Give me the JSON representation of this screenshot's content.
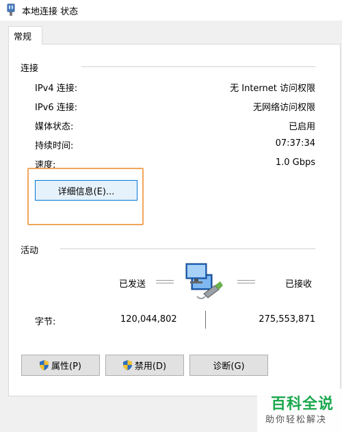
{
  "window": {
    "title": "本地连接 状态"
  },
  "tabs": [
    {
      "label": "常规"
    }
  ],
  "connection": {
    "group_label": "连接",
    "rows": [
      {
        "label": "IPv4 连接:",
        "value": "无 Internet 访问权限"
      },
      {
        "label": "IPv6 连接:",
        "value": "无网络访问权限"
      },
      {
        "label": "媒体状态:",
        "value": "已启用"
      },
      {
        "label": "持续时间:",
        "value": "07:37:34"
      },
      {
        "label": "速度:",
        "value": "1.0 Gbps"
      }
    ],
    "details_button": "详细信息(E)..."
  },
  "activity": {
    "group_label": "活动",
    "sent_label": "已发送",
    "received_label": "已接收",
    "bytes_label": "字节:",
    "bytes_sent": "120,044,802",
    "bytes_received": "275,553,871"
  },
  "buttons": {
    "properties": "属性(P)",
    "disable": "禁用(D)",
    "diagnose": "诊断(G)"
  },
  "watermark": {
    "main": "百科全说",
    "sub": "助你轻松解决"
  },
  "colors": {
    "highlight_box": "#f0a55b",
    "watermark_green": "#1aa84d",
    "shield_blue": "#2f6fc0",
    "shield_yellow": "#f2c230"
  }
}
